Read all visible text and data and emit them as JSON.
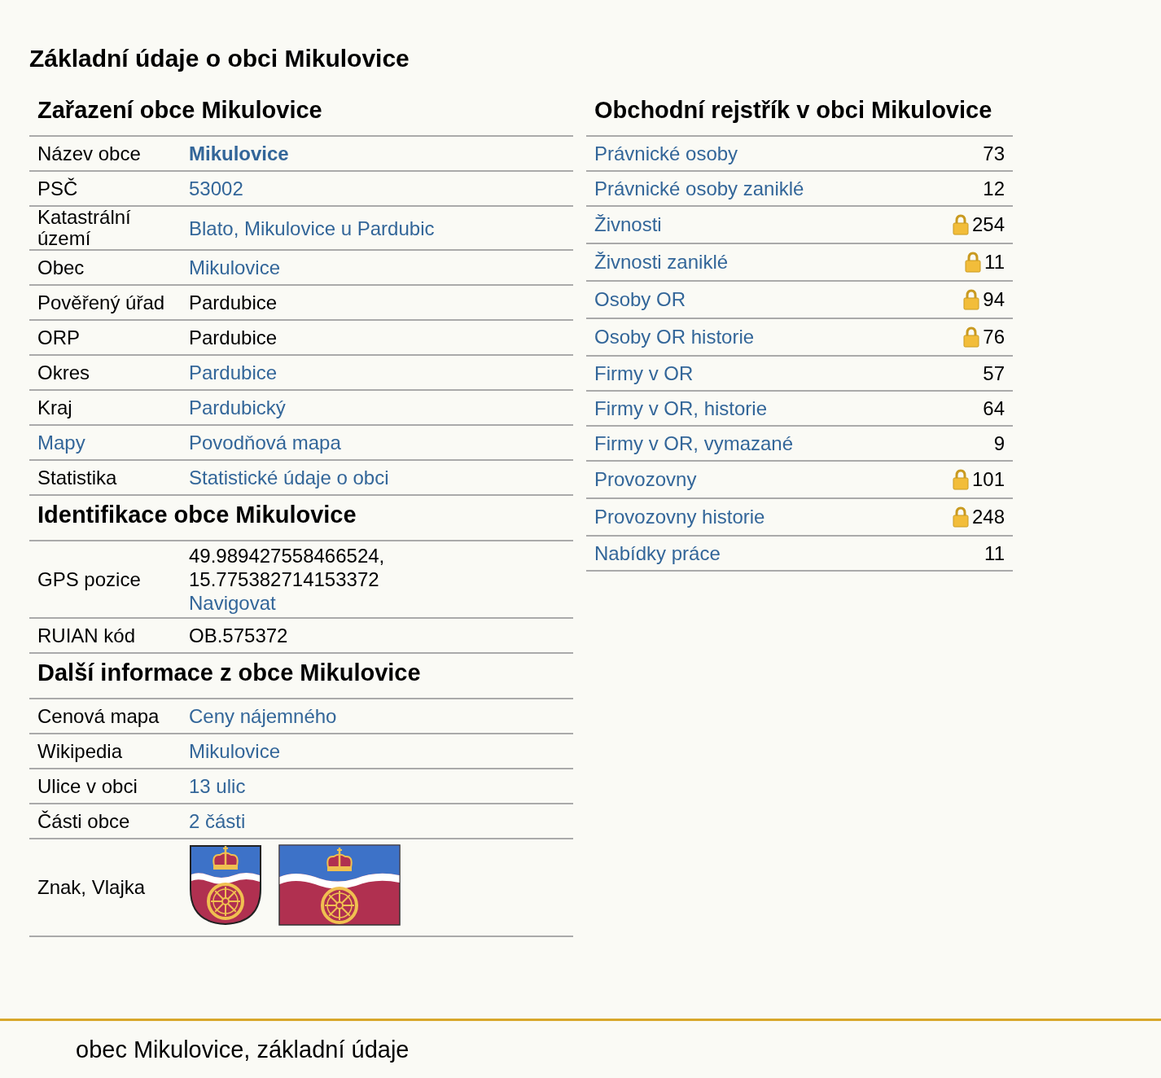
{
  "title": "Základní údaje o obci Mikulovice",
  "left_sections": [
    {
      "heading": "Zařazení obce Mikulovice",
      "rows": [
        {
          "label": "Název obce",
          "label_link": false,
          "kind": "lines",
          "lines": [
            {
              "text": "Mikulovice",
              "kind": "bold-link"
            }
          ]
        },
        {
          "label": "PSČ",
          "label_link": false,
          "kind": "lines",
          "lines": [
            {
              "text": "53002",
              "kind": "link"
            }
          ]
        },
        {
          "label": "Katastrální území",
          "label_link": false,
          "kind": "lines",
          "lines": [
            {
              "text": "Blato, Mikulovice u Pardubic",
              "kind": "link"
            }
          ]
        },
        {
          "label": "Obec",
          "label_link": false,
          "kind": "lines",
          "lines": [
            {
              "text": "Mikulovice",
              "kind": "link"
            }
          ]
        },
        {
          "label": "Pověřený úřad",
          "label_link": false,
          "kind": "lines",
          "lines": [
            {
              "text": "Pardubice",
              "kind": "text"
            }
          ]
        },
        {
          "label": "ORP",
          "label_link": false,
          "kind": "lines",
          "lines": [
            {
              "text": "Pardubice",
              "kind": "text"
            }
          ]
        },
        {
          "label": "Okres",
          "label_link": false,
          "kind": "lines",
          "lines": [
            {
              "text": "Pardubice",
              "kind": "link"
            }
          ]
        },
        {
          "label": "Kraj",
          "label_link": false,
          "kind": "lines",
          "lines": [
            {
              "text": "Pardubický",
              "kind": "link"
            }
          ]
        },
        {
          "label": "Mapy",
          "label_link": true,
          "kind": "lines",
          "lines": [
            {
              "text": "Povodňová mapa",
              "kind": "link"
            }
          ]
        },
        {
          "label": "Statistika",
          "label_link": false,
          "kind": "lines",
          "lines": [
            {
              "text": "Statistické údaje o obci",
              "kind": "link"
            }
          ]
        }
      ]
    },
    {
      "heading": "Identifikace obce Mikulovice",
      "rows": [
        {
          "label": "GPS pozice",
          "label_link": false,
          "kind": "lines",
          "lines": [
            {
              "text": "49.989427558466524,",
              "kind": "text"
            },
            {
              "text": "15.775382714153372",
              "kind": "text"
            },
            {
              "text": "Navigovat",
              "kind": "link"
            }
          ]
        },
        {
          "label": "RUIAN kód",
          "label_link": false,
          "kind": "lines",
          "lines": [
            {
              "text": "OB.575372",
              "kind": "text"
            }
          ]
        }
      ]
    },
    {
      "heading": "Další informace z obce Mikulovice",
      "rows": [
        {
          "label": "Cenová mapa",
          "label_link": false,
          "kind": "lines",
          "lines": [
            {
              "text": "Ceny nájemného",
              "kind": "link"
            }
          ]
        },
        {
          "label": "Wikipedia",
          "label_link": false,
          "kind": "lines",
          "lines": [
            {
              "text": "Mikulovice",
              "kind": "link"
            }
          ]
        },
        {
          "label": "Ulice v obci",
          "label_link": false,
          "kind": "lines",
          "lines": [
            {
              "text": "13 ulic",
              "kind": "link"
            }
          ]
        },
        {
          "label": "Části obce",
          "label_link": false,
          "kind": "lines",
          "lines": [
            {
              "text": "2 části",
              "kind": "link"
            }
          ]
        },
        {
          "label": "Znak, Vlajka",
          "label_link": false,
          "kind": "emblems"
        }
      ]
    }
  ],
  "register": {
    "heading": "Obchodní rejstřík v obci Mikulovice",
    "rows": [
      {
        "label": "Právnické osoby",
        "count": "73",
        "locked": false
      },
      {
        "label": "Právnické osoby zaniklé",
        "count": "12",
        "locked": false
      },
      {
        "label": "Živnosti",
        "count": "254",
        "locked": true
      },
      {
        "label": "Živnosti zaniklé",
        "count": "11",
        "locked": true
      },
      {
        "label": "Osoby OR",
        "count": "94",
        "locked": true
      },
      {
        "label": "Osoby OR historie",
        "count": "76",
        "locked": true
      },
      {
        "label": "Firmy v OR",
        "count": "57",
        "locked": false
      },
      {
        "label": "Firmy v OR, historie",
        "count": "64",
        "locked": false
      },
      {
        "label": "Firmy v OR, vymazané",
        "count": "9",
        "locked": false
      },
      {
        "label": "Provozovny",
        "count": "101",
        "locked": true
      },
      {
        "label": "Provozovny historie",
        "count": "248",
        "locked": true
      },
      {
        "label": "Nabídky práce",
        "count": "11",
        "locked": false
      }
    ]
  },
  "footer": {
    "text": "obec Mikulovice, základní údaje"
  }
}
